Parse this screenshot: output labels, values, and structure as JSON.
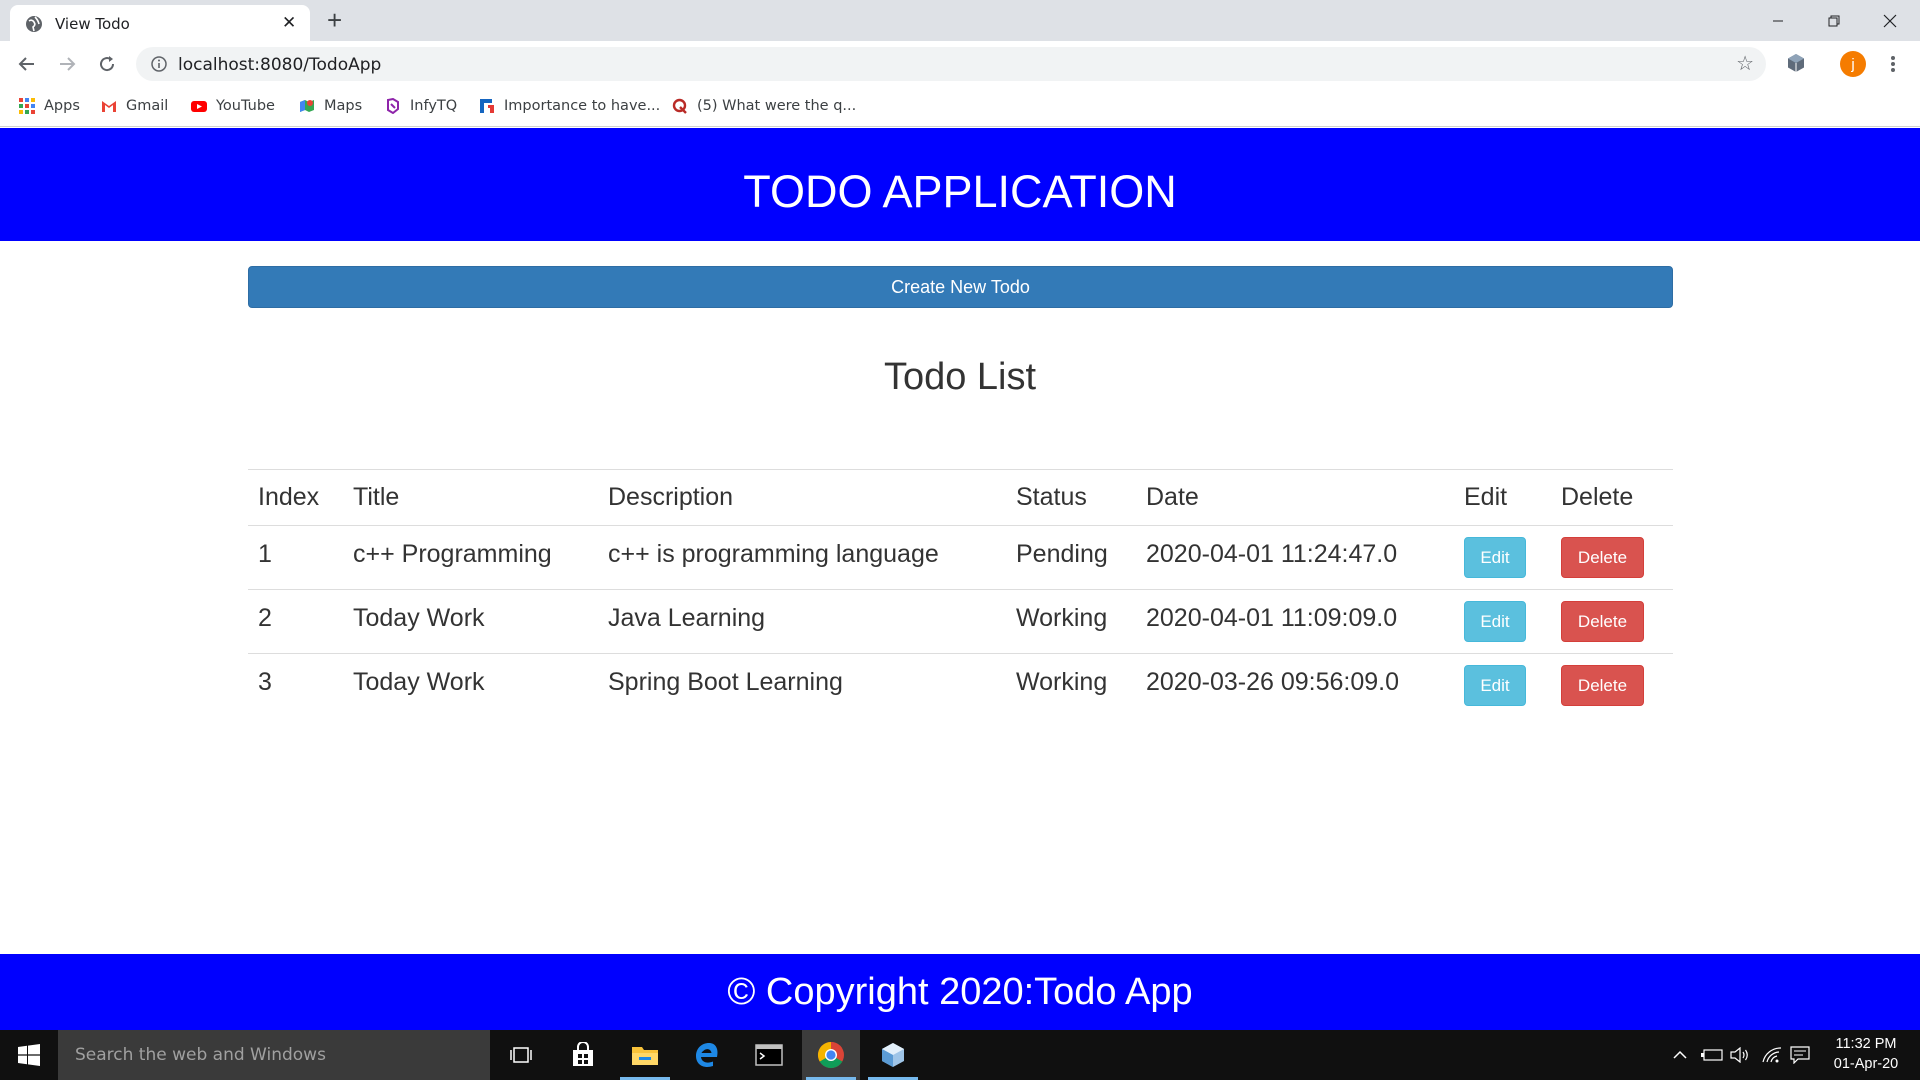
{
  "browser": {
    "tab_title": "View Todo",
    "url": "localhost:8080/TodoApp",
    "bookmarks": [
      "Apps",
      "Gmail",
      "YouTube",
      "Maps",
      "InfyTQ",
      "Importance to have...",
      "(5) What were the q..."
    ],
    "profile_initial": "j"
  },
  "page": {
    "header_title": "TODO APPLICATION",
    "create_button": "Create New Todo",
    "list_title": "Todo List",
    "table": {
      "columns": [
        "Index",
        "Title",
        "Description",
        "Status",
        "Date",
        "Edit",
        "Delete"
      ],
      "rows": [
        {
          "index": "1",
          "title": "c++ Programming",
          "description": "c++ is programming language",
          "status": "Pending",
          "date": "2020-04-01 11:24:47.0",
          "edit": "Edit",
          "delete": "Delete"
        },
        {
          "index": "2",
          "title": "Today Work",
          "description": "Java Learning",
          "status": "Working",
          "date": "2020-04-01 11:09:09.0",
          "edit": "Edit",
          "delete": "Delete"
        },
        {
          "index": "3",
          "title": "Today Work",
          "description": "Spring Boot Learning",
          "status": "Working",
          "date": "2020-03-26 09:56:09.0",
          "edit": "Edit",
          "delete": "Delete"
        }
      ]
    },
    "footer_text": "© Copyright 2020:Todo App"
  },
  "taskbar": {
    "search_placeholder": "Search the web and Windows",
    "time": "11:32 PM",
    "date": "01-Apr-20"
  },
  "colors": {
    "header_bg": "#0000ff",
    "primary_button": "#337ab7",
    "edit_button": "#5bc0de",
    "delete_button": "#d9534f"
  }
}
